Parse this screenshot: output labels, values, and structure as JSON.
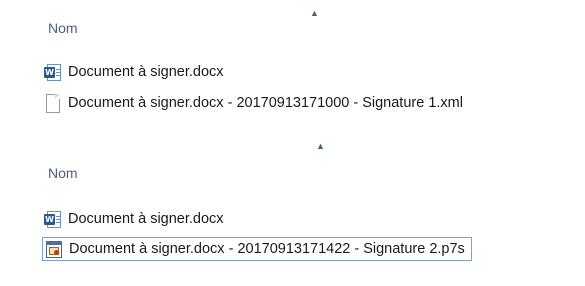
{
  "top_pane": {
    "column_header": {
      "label": "Nom",
      "sort": "ascending"
    },
    "files": [
      {
        "name": "Document à signer.docx",
        "icon": "word-document-icon"
      },
      {
        "name": "Document à signer.docx - 20170913171000 - Signature 1.xml",
        "icon": "xml-file-icon"
      }
    ]
  },
  "bottom_pane": {
    "column_header": {
      "label": "Nom",
      "sort": "ascending"
    },
    "files": [
      {
        "name": "Document à signer.docx",
        "icon": "word-document-icon"
      },
      {
        "name": "Document à signer.docx - 20170913171422 - Signature 2.p7s",
        "icon": "p7s-signature-icon",
        "selected": true
      }
    ]
  },
  "colors": {
    "header_text": "#4c607a",
    "selection_border": "#7da2ce",
    "word_blue": "#2b5797"
  }
}
